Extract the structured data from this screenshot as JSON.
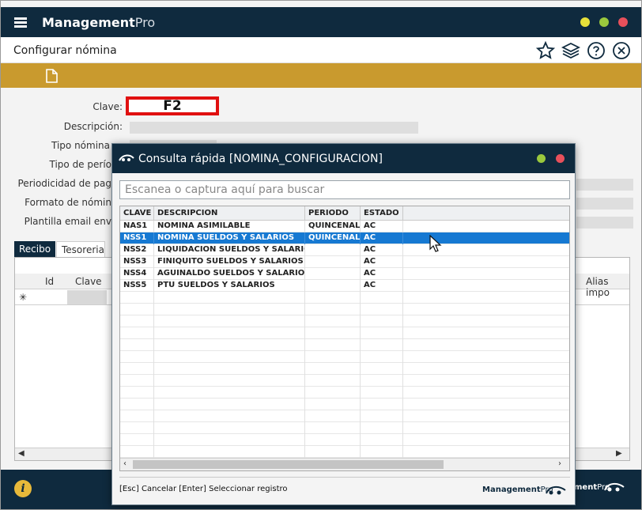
{
  "app": {
    "brand_bold": "Management",
    "brand_light": "Pro",
    "window_buttons": [
      "minimize",
      "maximize",
      "close"
    ],
    "colors": {
      "titlebar": "#0f2a3e",
      "gold": "#c99a2e",
      "selected_row": "#1679d2",
      "yellow_btn": "#e7e03a",
      "green_btn": "#9ac83d",
      "red_btn": "#e8505b"
    }
  },
  "header": {
    "title": "Configurar nómina",
    "icons": [
      "star-icon",
      "layers-icon",
      "help-icon",
      "close-icon"
    ]
  },
  "toolbar": {
    "icons": [
      "new-document-icon"
    ]
  },
  "form": {
    "clave_label": "Clave:",
    "clave_value": "F2",
    "descripcion_label": "Descripción:",
    "tipo_nomina_label": "Tipo nómina",
    "tipo_periodo_label": "Tipo de perío",
    "periodicidad_label": "Periodicidad de pag",
    "formato_label": "Formato de nómin",
    "plantilla_label": "Plantilla email env"
  },
  "tabs": [
    {
      "label": "Recibo",
      "active": true
    },
    {
      "label": "Tesoreria",
      "active": false
    }
  ],
  "background_grid": {
    "columns": [
      "Id",
      "Clave"
    ],
    "right_column": "Alias impo",
    "new_row_marker": "✳"
  },
  "dialog": {
    "title": "Consulta rápida [NOMINA_CONFIGURACION]",
    "search_placeholder": "Escanea o captura aquí para buscar",
    "columns": [
      "CLAVE",
      "DESCRIPCION",
      "PERIODO",
      "ESTADO"
    ],
    "rows": [
      {
        "clave": "NAS1",
        "descripcion": "NOMINA ASIMILABLE",
        "periodo": "QUINCENAL",
        "estado": "AC",
        "selected": false
      },
      {
        "clave": "NSS1",
        "descripcion": "NOMINA SUELDOS Y SALARIOS",
        "periodo": "QUINCENAL",
        "estado": "AC",
        "selected": true
      },
      {
        "clave": "NSS2",
        "descripcion": "LIQUIDACION SUELDOS Y SALARIOS",
        "periodo": "",
        "estado": "AC",
        "selected": false
      },
      {
        "clave": "NSS3",
        "descripcion": "FINIQUITO SUELDOS Y SALARIOS",
        "periodo": "",
        "estado": "AC",
        "selected": false
      },
      {
        "clave": "NSS4",
        "descripcion": "AGUINALDO SUELDOS Y SALARIOS",
        "periodo": "",
        "estado": "AC",
        "selected": false
      },
      {
        "clave": "NSS5",
        "descripcion": "PTU SUELDOS Y SALARIOS",
        "periodo": "",
        "estado": "AC",
        "selected": false
      }
    ],
    "footer_hint": "[Esc] Cancelar  [Enter] Seleccionar registro",
    "footer_brand_bold": "Management",
    "footer_brand_light": "Pro"
  },
  "footer": {
    "info_icon": "i",
    "brand_bold": "ment",
    "brand_light": "Pro"
  }
}
